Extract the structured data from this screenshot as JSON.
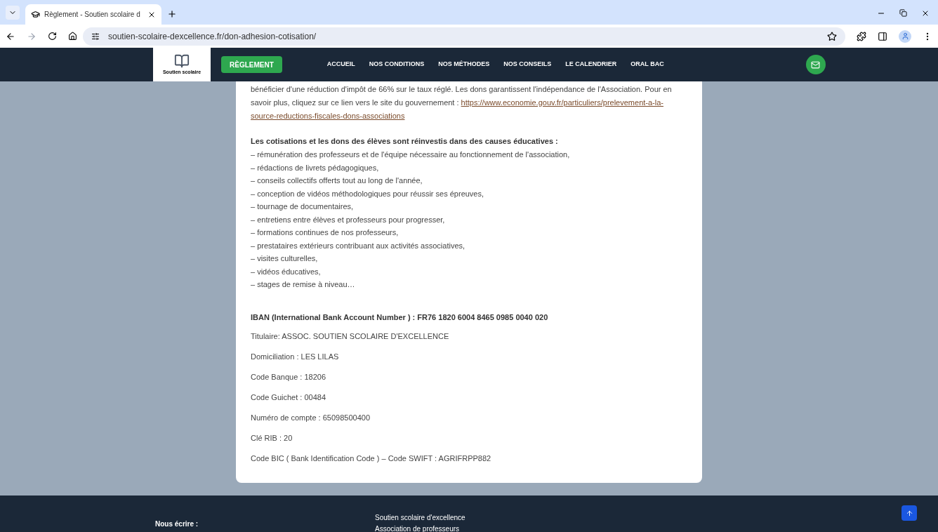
{
  "browser": {
    "tab_title": "Règlement - Soutien scolaire d",
    "url": "soutien-scolaire-dexcellence.fr/don-adhesion-cotisation/"
  },
  "header": {
    "logo_text": "Soutien scolaire",
    "cta": "RÈGLEMENT",
    "nav": [
      {
        "label": "ACCUEIL"
      },
      {
        "label": "NOS CONDITIONS"
      },
      {
        "label": "NOS MÉTHODES"
      },
      {
        "label": "NOS CONSEILS"
      },
      {
        "label": "LE CALENDRIER"
      },
      {
        "label": "ORAL BAC"
      }
    ]
  },
  "content": {
    "intro_lines": [
      "bénéficier d'une réduction d'impôt de 66% sur le taux réglé. Les dons garantissent l'indépendance de l'Association. Pour en",
      "savoir plus, cliquez sur ce lien vers le site du gouvernement :"
    ],
    "link_lines": [
      "https://www.economie.gouv.fr/particuliers/prelevement-a-la-",
      "source-reductions-fiscales-dons-associations"
    ],
    "list_heading": "Les cotisations et les dons des élèves sont réinvestis dans des causes éducatives :",
    "list": [
      "– rémunération des professeurs et de l'équipe nécessaire au fonctionnement de l'association,",
      "– rédactions de livrets pédagogiques,",
      "– conseils collectifs offerts tout au long de l'année,",
      "– conception de vidéos méthodologiques pour réussir ses épreuves,",
      "– tournage de documentaires,",
      "– entretiens entre élèves et professeurs pour progresser,",
      "– formations continues de nos professeurs,",
      "– prestataires extérieurs contribuant aux activités associatives,",
      "– visites culturelles,",
      "– vidéos éducatives,",
      "– stages de remise à niveau…"
    ],
    "iban": "IBAN (International Bank Account Number ) : FR76 1820 6004 8465 0985 0040 020",
    "details": [
      "Titulaire: ASSOC. SOUTIEN SCOLAIRE D'EXCELLENCE",
      "Domiciliation : LES LILAS",
      "Code Banque : 18206",
      "Code Guichet : 00484",
      "Numéro de compte : 65098500400",
      "Clé RIB : 20",
      "Code BIC ( Bank Identification Code ) – Code SWIFT : AGRIFRPP882"
    ]
  },
  "footer": {
    "contact_heading": "Nous écrire :",
    "lines": [
      "Soutien scolaire d'excellence",
      "Association de professeurs"
    ]
  }
}
